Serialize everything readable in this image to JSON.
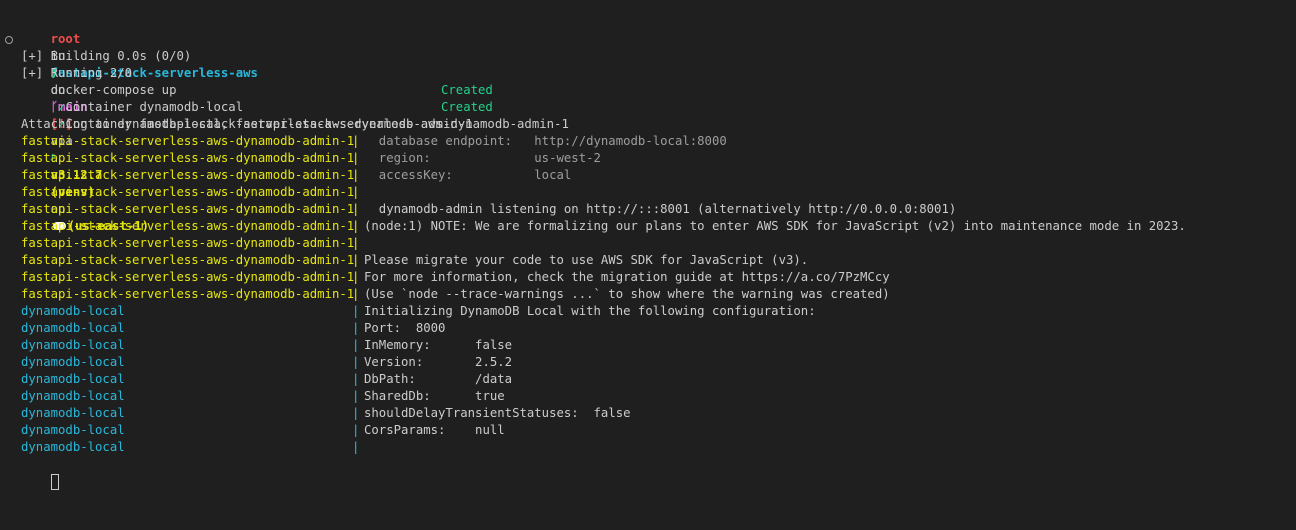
{
  "prompt": {
    "user": "root",
    "in_word": "in",
    "directory": "fastapi-stack-serverless-aws",
    "on_word": "on",
    "branch_icon": "ᚴ",
    "branch": "main",
    "git_status": "[!]",
    "via_word": "via",
    "python_icon": "ℓ",
    "python_version": "v3.12.7",
    "venv": "(venv)",
    "on_word2": "on",
    "aws_region": "(us-east-1)",
    "arrow": "❯",
    "command": "docker-compose up"
  },
  "compose": {
    "building": "[+] Building 0.0s (0/0)",
    "running": "[+] Running 2/0",
    "containers": [
      {
        "check": "✓",
        "name": "Container dynamodb-local",
        "state": "Created"
      },
      {
        "check": "✓",
        "name": "Container fastapi-stack-serverless-aws-dynamodb-admin-1",
        "state": "Created"
      }
    ],
    "attaching": "Attaching to dynamodb-local, fastapi-stack-serverless-aws-dynamodb-admin-1"
  },
  "logs": [
    {
      "service": "fastapi-stack-serverless-aws-dynamodb-admin-1",
      "sep": "|",
      "text": "  database endpoint:   http://dynamodb-local:8000",
      "svc_color": "yellow",
      "text_color": "gray"
    },
    {
      "service": "fastapi-stack-serverless-aws-dynamodb-admin-1",
      "sep": "|",
      "text": "  region:              us-west-2",
      "svc_color": "yellow",
      "text_color": "gray"
    },
    {
      "service": "fastapi-stack-serverless-aws-dynamodb-admin-1",
      "sep": "|",
      "text": "  accessKey:           local",
      "svc_color": "yellow",
      "text_color": "gray"
    },
    {
      "service": "fastapi-stack-serverless-aws-dynamodb-admin-1",
      "sep": "|",
      "text": "",
      "svc_color": "yellow",
      "text_color": "dim"
    },
    {
      "service": "fastapi-stack-serverless-aws-dynamodb-admin-1",
      "sep": "|",
      "text": "  dynamodb-admin listening on http://:::8001 (alternatively http://0.0.0.0:8001)",
      "svc_color": "yellow",
      "text_color": "dim"
    },
    {
      "service": "fastapi-stack-serverless-aws-dynamodb-admin-1",
      "sep": "|",
      "text": "(node:1) NOTE: We are formalizing our plans to enter AWS SDK for JavaScript (v2) into maintenance mode in 2023.",
      "svc_color": "yellow",
      "text_color": "dim"
    },
    {
      "service": "fastapi-stack-serverless-aws-dynamodb-admin-1",
      "sep": "|",
      "text": "",
      "svc_color": "yellow",
      "text_color": "dim"
    },
    {
      "service": "fastapi-stack-serverless-aws-dynamodb-admin-1",
      "sep": "|",
      "text": "Please migrate your code to use AWS SDK for JavaScript (v3).",
      "svc_color": "yellow",
      "text_color": "dim"
    },
    {
      "service": "fastapi-stack-serverless-aws-dynamodb-admin-1",
      "sep": "|",
      "text": "For more information, check the migration guide at https://a.co/7PzMCcy",
      "svc_color": "yellow",
      "text_color": "dim"
    },
    {
      "service": "fastapi-stack-serverless-aws-dynamodb-admin-1",
      "sep": "|",
      "text": "(Use `node --trace-warnings ...` to show where the warning was created)",
      "svc_color": "yellow",
      "text_color": "dim"
    },
    {
      "service": "dynamodb-local",
      "sep": "|",
      "text": "Initializing DynamoDB Local with the following configuration:",
      "svc_color": "cyan",
      "text_color": "dim"
    },
    {
      "service": "dynamodb-local",
      "sep": "|",
      "text": "Port:  8000",
      "svc_color": "cyan",
      "text_color": "dim"
    },
    {
      "service": "dynamodb-local",
      "sep": "|",
      "text": "InMemory:      false",
      "svc_color": "cyan",
      "text_color": "dim"
    },
    {
      "service": "dynamodb-local",
      "sep": "|",
      "text": "Version:       2.5.2",
      "svc_color": "cyan",
      "text_color": "dim"
    },
    {
      "service": "dynamodb-local",
      "sep": "|",
      "text": "DbPath:        /data",
      "svc_color": "cyan",
      "text_color": "dim"
    },
    {
      "service": "dynamodb-local",
      "sep": "|",
      "text": "SharedDb:      true",
      "svc_color": "cyan",
      "text_color": "dim"
    },
    {
      "service": "dynamodb-local",
      "sep": "|",
      "text": "shouldDelayTransientStatuses:  false",
      "svc_color": "cyan",
      "text_color": "dim"
    },
    {
      "service": "dynamodb-local",
      "sep": "|",
      "text": "CorsParams:    null",
      "svc_color": "cyan",
      "text_color": "dim"
    },
    {
      "service": "dynamodb-local",
      "sep": "|",
      "text": "",
      "svc_color": "cyan",
      "text_color": "dim"
    }
  ]
}
